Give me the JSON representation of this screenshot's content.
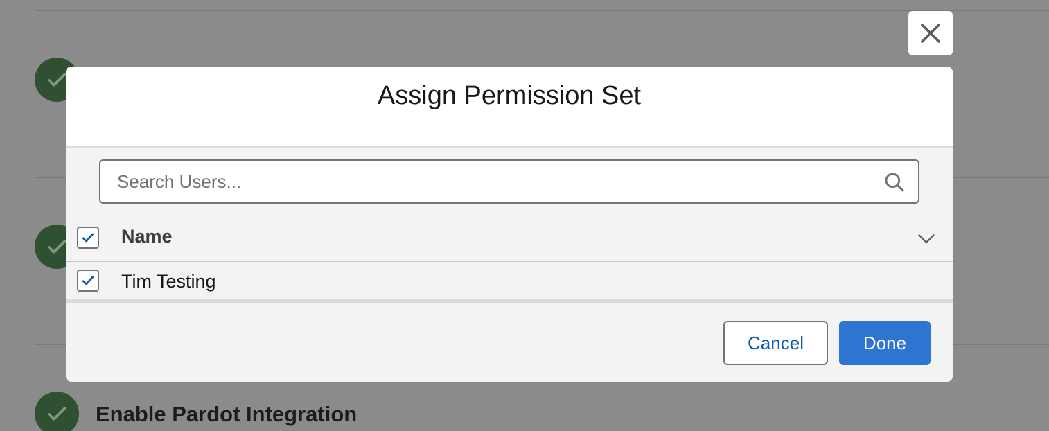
{
  "background": {
    "step_title": "Enable Pardot Integration"
  },
  "modal": {
    "title": "Assign Permission Set",
    "search": {
      "placeholder": "Search Users...",
      "value": ""
    },
    "table": {
      "columns": [
        "Name"
      ],
      "select_all_checked": true,
      "rows": [
        {
          "name": "Tim Testing",
          "checked": true
        }
      ]
    },
    "footer": {
      "cancel_label": "Cancel",
      "done_label": "Done"
    }
  },
  "icons": {
    "close": "close-icon",
    "search": "search-icon",
    "check": "check-icon",
    "chevron": "chevron-down-icon"
  },
  "colors": {
    "brand": "#2e74d1",
    "link": "#0b5cab",
    "step_complete": "#2f5132",
    "overlay": "#8b8b8b"
  }
}
